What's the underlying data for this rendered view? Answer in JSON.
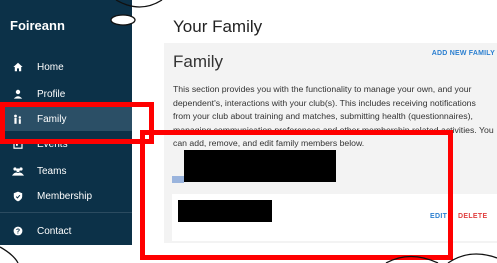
{
  "sidebar": {
    "brand": "Foireann",
    "items": [
      {
        "label": "Home",
        "icon": "home-icon"
      },
      {
        "label": "Profile",
        "icon": "person-icon"
      },
      {
        "label": "Family",
        "icon": "family-icon",
        "active": true
      },
      {
        "label": "Events",
        "icon": "calendar-icon"
      },
      {
        "label": "Teams",
        "icon": "group-icon"
      },
      {
        "label": "Membership",
        "icon": "shield-icon"
      },
      {
        "label": "Contact",
        "icon": "help-icon"
      }
    ]
  },
  "page": {
    "title": "Your Family",
    "heading": "Family",
    "add_button": "ADD NEW FAMILY",
    "description": "This section provides you with the functionality to manage your own, and your dependent's, interactions with your club(s). This includes receiving notifications from your club about training and matches, submitting health (questionnaires), managing communication preferences and other membership related activities. You can add, remove, and edit family members below."
  },
  "member": {
    "edit_label": "EDIT",
    "delete_label": "DELETE"
  },
  "colors": {
    "sidebar_bg": "#0c3148",
    "active_item_bg": "#2b4f66",
    "link_blue": "#2b7fd0",
    "delete_red": "#e04040",
    "highlight_red": "#ff0000"
  }
}
